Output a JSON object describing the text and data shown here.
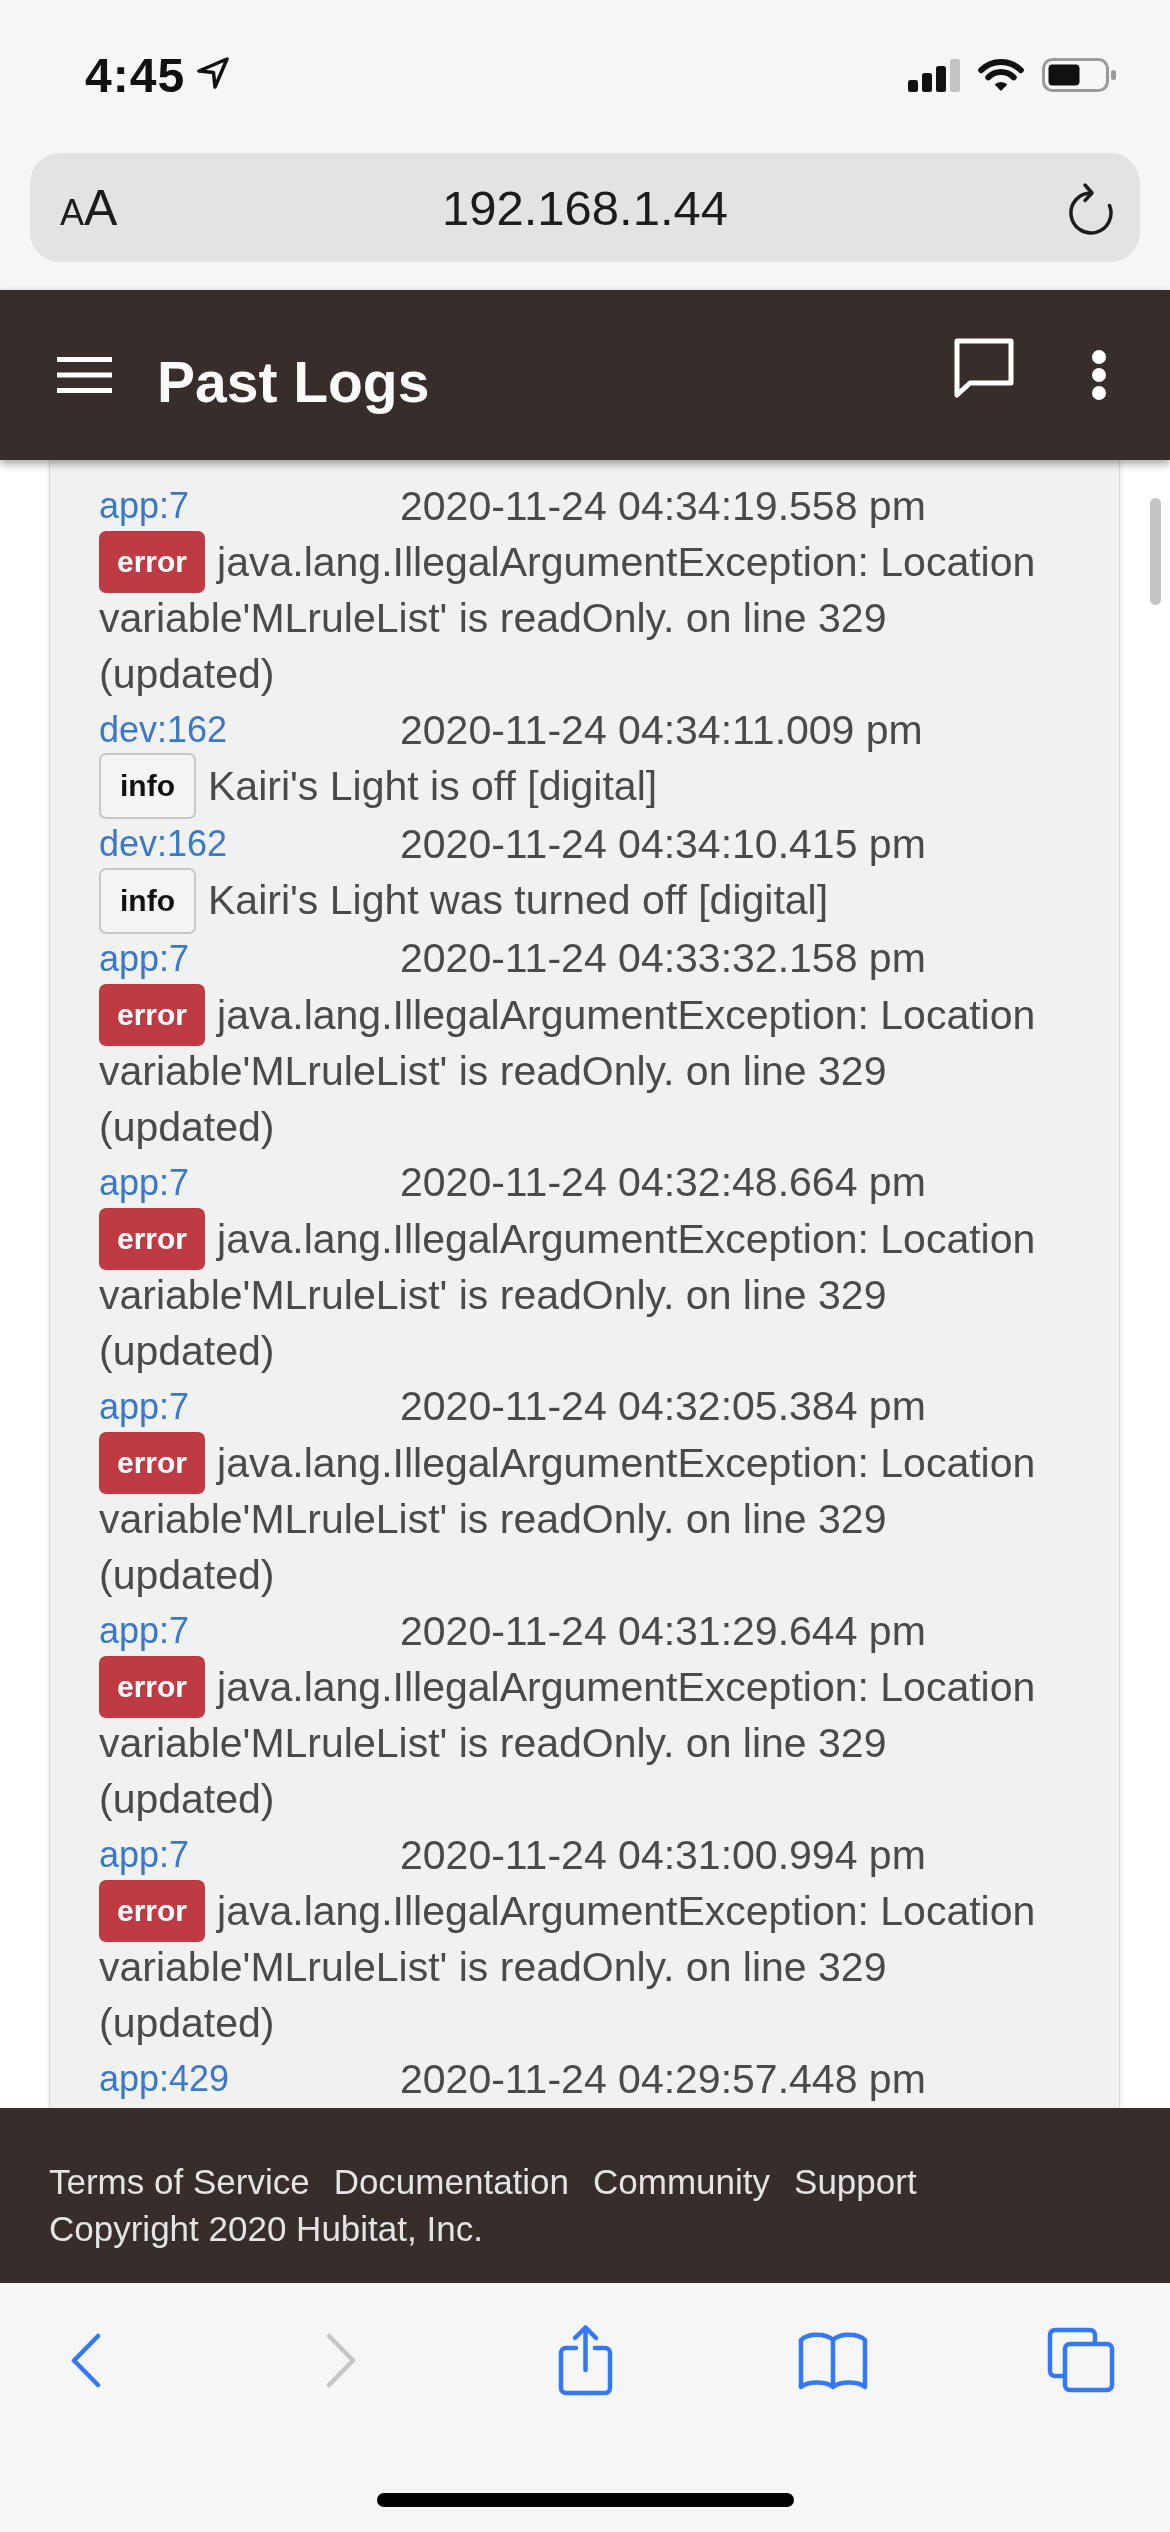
{
  "status_bar": {
    "time": "4:45"
  },
  "browser": {
    "text_size_button": "AA",
    "url": "192.168.1.44"
  },
  "app_bar": {
    "title": "Past Logs"
  },
  "logs": [
    {
      "source": "app:7",
      "time": "2020-11-24 04:34:19.558 pm",
      "kind": "error",
      "badge": "error",
      "message": "java.lang.IllegalArgumentException: Location variable'MLruleList' is readOnly. on line 329 (updated)"
    },
    {
      "source": "dev:162",
      "time": "2020-11-24 04:34:11.009 pm",
      "kind": "info",
      "badge": "info",
      "message": "Kairi's Light is off [digital]"
    },
    {
      "source": "dev:162",
      "time": "2020-11-24 04:34:10.415 pm",
      "kind": "info",
      "badge": "info",
      "message": "Kairi's Light was turned off [digital]"
    },
    {
      "source": "app:7",
      "time": "2020-11-24 04:33:32.158 pm",
      "kind": "error",
      "badge": "error",
      "message": "java.lang.IllegalArgumentException: Location variable'MLruleList' is readOnly. on line 329 (updated)"
    },
    {
      "source": "app:7",
      "time": "2020-11-24 04:32:48.664 pm",
      "kind": "error",
      "badge": "error",
      "message": "java.lang.IllegalArgumentException: Location variable'MLruleList' is readOnly. on line 329 (updated)"
    },
    {
      "source": "app:7",
      "time": "2020-11-24 04:32:05.384 pm",
      "kind": "error",
      "badge": "error",
      "message": "java.lang.IllegalArgumentException: Location variable'MLruleList' is readOnly. on line 329 (updated)"
    },
    {
      "source": "app:7",
      "time": "2020-11-24 04:31:29.644 pm",
      "kind": "error",
      "badge": "error",
      "message": "java.lang.IllegalArgumentException: Location variable'MLruleList' is readOnly. on line 329 (updated)"
    },
    {
      "source": "app:7",
      "time": "2020-11-24 04:31:00.994 pm",
      "kind": "error",
      "badge": "error",
      "message": "java.lang.IllegalArgumentException: Location variable'MLruleList' is readOnly. on line 329 (updated)"
    },
    {
      "source": "app:429",
      "time": "2020-11-24 04:29:57.448 pm"
    }
  ],
  "footer": {
    "links": [
      "Terms of Service",
      "Documentation",
      "Community",
      "Support"
    ],
    "copyright": "Copyright 2020 Hubitat, Inc."
  },
  "toolbar": {
    "back_disabled": false,
    "forward_disabled": true
  }
}
